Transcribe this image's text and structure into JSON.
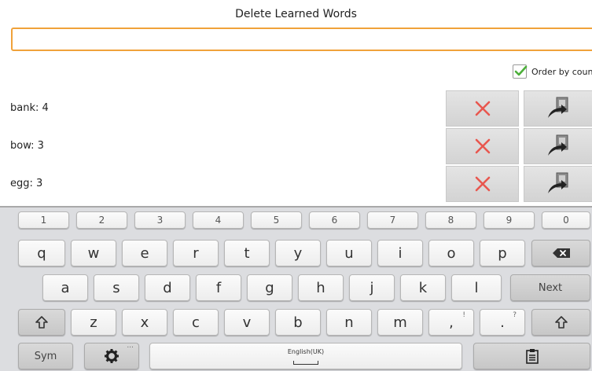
{
  "header": {
    "title": "Delete Learned Words"
  },
  "search": {
    "value": "",
    "placeholder": ""
  },
  "order_by": {
    "label": "Order by coun",
    "checked": true
  },
  "words": [
    {
      "label": "bank: 4"
    },
    {
      "label": "bow: 3"
    },
    {
      "label": "egg: 3"
    }
  ],
  "colors": {
    "accent": "#f0a23a",
    "delete": "#e8574f",
    "check": "#4caf3a"
  },
  "icons": {
    "delete": "close-icon",
    "move": "export-arrow-icon",
    "settings": "gear-icon",
    "clipboard": "clipboard-icon",
    "shift": "shift-arrow-icon",
    "backspace": "backspace-icon"
  },
  "keyboard": {
    "numbers": [
      "1",
      "2",
      "3",
      "4",
      "5",
      "6",
      "7",
      "8",
      "9",
      "0"
    ],
    "row1": [
      "q",
      "w",
      "e",
      "r",
      "t",
      "y",
      "u",
      "i",
      "o",
      "p"
    ],
    "row2": [
      "a",
      "s",
      "d",
      "f",
      "g",
      "h",
      "j",
      "k",
      "l"
    ],
    "row3": [
      "z",
      "x",
      "c",
      "v",
      "b",
      "n",
      "m"
    ],
    "comma": ",",
    "comma_alt": "!",
    "period": ".",
    "period_alt": "?",
    "next_label": "Next",
    "sym_label": "Sym",
    "space_label": "English(UK)",
    "settings_more": "..."
  }
}
